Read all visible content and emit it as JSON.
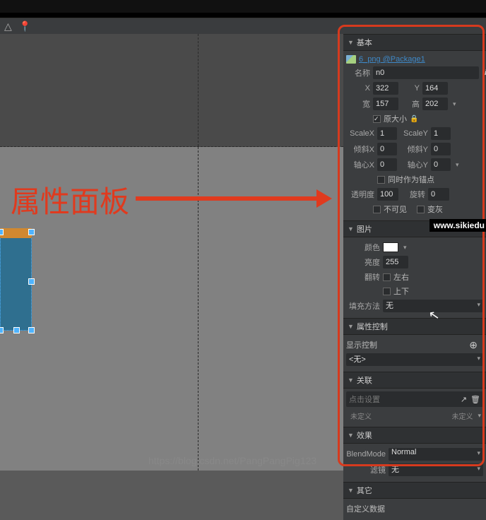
{
  "toolbar": {
    "triangle": "△",
    "pin": "📍"
  },
  "annotation": {
    "label": "属性面板"
  },
  "panel": {
    "basic": {
      "title": "基本",
      "asset_link": "6_png @Package1",
      "name_lbl": "名称",
      "name_val": "n0",
      "x_lbl": "X",
      "x_val": "322",
      "y_lbl": "Y",
      "y_val": "164",
      "w_lbl": "宽",
      "w_val": "157",
      "h_lbl": "高",
      "h_val": "202",
      "origsize_lbl": "原大小",
      "scalex_lbl": "ScaleX",
      "scalex_val": "1",
      "scaley_lbl": "ScaleY",
      "scaley_val": "1",
      "skewx_lbl": "倾斜X",
      "skewx_val": "0",
      "skewy_lbl": "倾斜Y",
      "skewy_val": "0",
      "pivotx_lbl": "轴心X",
      "pivotx_val": "0",
      "pivoty_lbl": "轴心Y",
      "pivoty_val": "0",
      "anchor_lbl": "同时作为锚点",
      "alpha_lbl": "透明度",
      "alpha_val": "100",
      "rotate_lbl": "旋转",
      "rotate_val": "0",
      "invisible_lbl": "不可见",
      "gray_lbl": "变灰"
    },
    "image": {
      "title": "图片",
      "color_lbl": "颜色",
      "bright_lbl": "亮度",
      "bright_val": "255",
      "flip_lbl": "翻转",
      "flip_h": "左右",
      "flip_v": "上下",
      "fill_lbl": "填充方法",
      "fill_val": "无"
    },
    "propctrl": {
      "title": "属性控制",
      "display_lbl": "显示控制",
      "display_val": "<无>"
    },
    "relation": {
      "title": "关联",
      "placeholder": "点击设置",
      "undef_l": "未定义",
      "undef_r": "未定义"
    },
    "effect": {
      "title": "效果",
      "blend_lbl": "BlendMode",
      "blend_val": "Normal",
      "filter_lbl": "滤镜",
      "filter_val": "无"
    },
    "other": {
      "title": "其它",
      "custom_lbl": "自定义数据"
    }
  },
  "watermark": "https://blog.csdn.net/PangPangPig123",
  "site": "www.sikiedu"
}
